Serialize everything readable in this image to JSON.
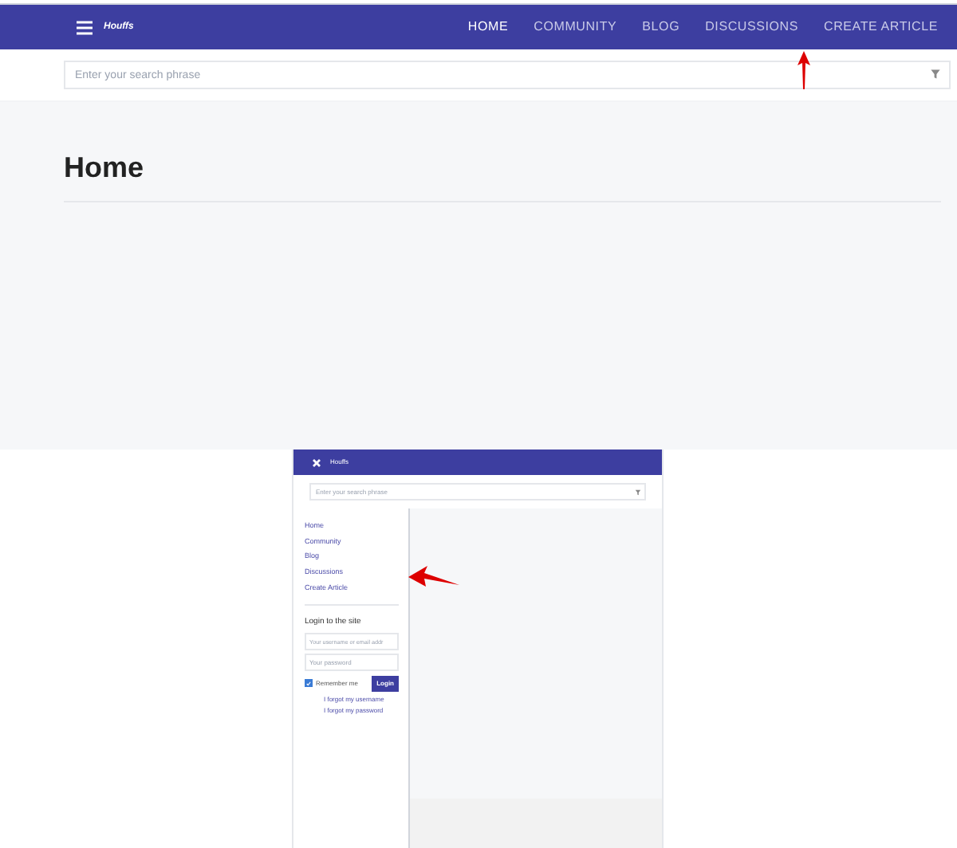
{
  "desktop": {
    "logo": "Houffs",
    "nav": [
      {
        "label": "HOME",
        "selected": true
      },
      {
        "label": "COMMUNITY",
        "selected": false
      },
      {
        "label": "BLOG",
        "selected": false
      },
      {
        "label": "DISCUSSIONS",
        "selected": false
      },
      {
        "label": "CREATE ARTICLE",
        "selected": false
      }
    ],
    "search": {
      "placeholder": "Enter your search phrase"
    },
    "heading": "Home"
  },
  "mobile": {
    "logo": "Houffs",
    "search": {
      "placeholder": "Enter your search phrase"
    },
    "menu": [
      {
        "label": "Home"
      },
      {
        "label": "Community"
      },
      {
        "label": "Blog"
      },
      {
        "label": "Discussions"
      },
      {
        "label": "Create Article"
      }
    ],
    "login": {
      "title": "Login to the site",
      "username": {
        "placeholder": "Your username or email addr"
      },
      "password": {
        "placeholder": "Your password"
      },
      "remember": {
        "label": "Remember me",
        "checked": true
      },
      "button": "Login",
      "links": [
        "I forgot my username",
        "I forgot my password"
      ]
    }
  }
}
